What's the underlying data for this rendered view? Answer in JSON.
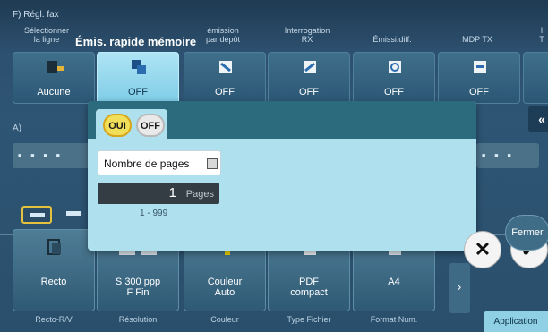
{
  "header": {
    "title": "F)  Régl. fax"
  },
  "tabs": [
    {
      "label": "Sélectionner\nla ligne"
    },
    {
      "label": "Émis. rapide mémoire"
    },
    {
      "label": "émission\npar dépôt"
    },
    {
      "label": "Interrogation\nRX"
    },
    {
      "label": "Émissi.diff."
    },
    {
      "label": "MDP TX"
    },
    {
      "label": "I\nT"
    }
  ],
  "tiles": [
    {
      "value": "Aucune",
      "icon": "line-select-icon"
    },
    {
      "value": "OFF",
      "icon": "quick-memory-tx-icon"
    },
    {
      "value": "OFF",
      "icon": "bulletin-tx-icon"
    },
    {
      "value": "OFF",
      "icon": "polling-rx-icon"
    },
    {
      "value": "OFF",
      "icon": "timer-tx-icon"
    },
    {
      "value": "OFF",
      "icon": "password-tx-icon"
    }
  ],
  "section": {
    "label": "A)"
  },
  "collapse": {
    "label": "«"
  },
  "popup": {
    "on_label": "OUI",
    "off_label": "OFF",
    "page_count_label": "Nombre de pages",
    "page_count_value": "1",
    "page_unit": "Pages",
    "range": "1 - 999",
    "cancel_symbol": "✕",
    "ok_symbol": "✔"
  },
  "close_label": "Fermer",
  "bottom_tiles": [
    {
      "value": "Recto",
      "label": "Recto-R/V",
      "icon": "simplex-icon"
    },
    {
      "value": "S 300 ppp\nF Fin",
      "label": "Résolution",
      "icon": "resolution-icon"
    },
    {
      "value": "Couleur\nAuto",
      "label": "Couleur",
      "icon": "color-icon"
    },
    {
      "value": "PDF\ncompact",
      "label": "Type Fichier",
      "icon": "pdf-file-icon"
    },
    {
      "value": "A4",
      "label": "Format Num.",
      "icon": "scan-size-icon"
    }
  ],
  "next_symbol": "›",
  "application_label": "Application",
  "colors": {
    "accent": "#aee0ee",
    "yellow": "#f2df59",
    "bg": "#2b4a63"
  }
}
